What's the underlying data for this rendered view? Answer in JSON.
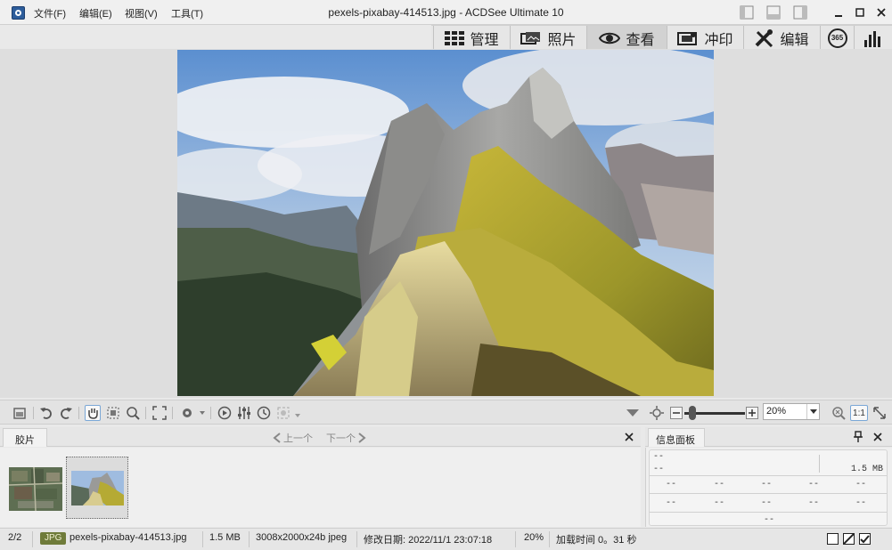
{
  "window": {
    "title": "pexels-pixabay-414513.jpg - ACDSee Ultimate 10",
    "app_icon": "acdsee-icon"
  },
  "menu": [
    "文件(F)",
    "编辑(E)",
    "视图(V)",
    "工具(T)"
  ],
  "modes": [
    {
      "label": "管理",
      "icon": "grid-icon",
      "active": false
    },
    {
      "label": "照片",
      "icon": "photos-icon",
      "active": false
    },
    {
      "label": "查看",
      "icon": "eye-icon",
      "active": true
    },
    {
      "label": "冲印",
      "icon": "develop-icon",
      "active": false
    },
    {
      "label": "编辑",
      "icon": "edit-tools-icon",
      "active": false
    }
  ],
  "mode_extra": [
    "365",
    "stats-icon"
  ],
  "toolbar": {
    "zoom_value": "20%",
    "one_to_one": "1:1"
  },
  "filmstrip": {
    "title": "胶片",
    "prev": "上一个",
    "next": "下一个",
    "thumbnails": [
      {
        "name": "aerial-thumbnail",
        "selected": false
      },
      {
        "name": "mountain-thumbnail",
        "selected": true
      }
    ]
  },
  "info_panel": {
    "title": "信息面板",
    "top_left": "--",
    "row1_left": "--",
    "row1_right": "1.5 MB",
    "grid_row1": [
      "--",
      "--",
      "--",
      "--",
      "--"
    ],
    "grid_row2": [
      "--",
      "--",
      "--",
      "--",
      "--"
    ],
    "bottom": "--"
  },
  "status": {
    "position": "2/2",
    "format": "JPG",
    "filename": "pexels-pixabay-414513.jpg",
    "size": "1.5 MB",
    "dimensions": "3008x2000x24b jpeg",
    "modified": "修改日期: 2022/11/1 23:07:18",
    "zoom": "20%",
    "load_time": "加载时间 0。31 秒"
  },
  "colors": {
    "accent": "#4a90c8",
    "badge_bg": "#6f7b3a"
  }
}
